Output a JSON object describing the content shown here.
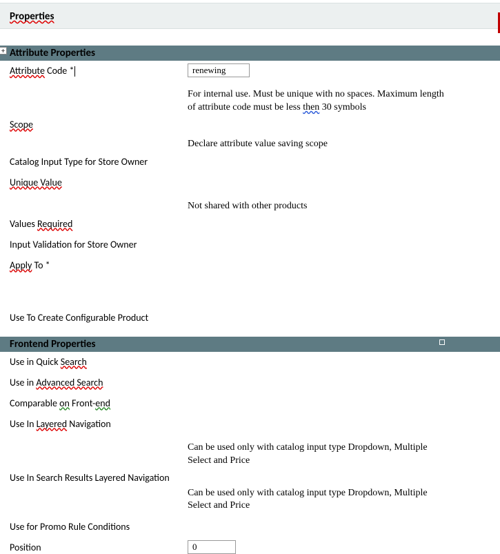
{
  "page": {
    "title": "Properties"
  },
  "sections": {
    "attr": {
      "title": "Attribute Properties"
    },
    "front": {
      "title": "Frontend Properties"
    }
  },
  "attr": {
    "code_label_1": "Attribute",
    "code_label_2": " Code ",
    "code_value": "renewing",
    "code_help_1": "For internal use. Must be unique with no spaces. Maximum length of attribute code must be less ",
    "code_help_then": "then",
    "code_help_2": " 30 symbols",
    "scope_label": "Scope",
    "scope_help": "Declare attribute value saving scope",
    "input_type_label": "Catalog Input Type for Store Owner",
    "unique_label": "Unique Value",
    "unique_help": "Not shared with other products",
    "required_label_1": "Values ",
    "required_label_2": "Required",
    "validation_label": "Input Validation for Store Owner",
    "apply_label_1": "Apply",
    "apply_label_2": " To *",
    "config_label": "Use To Create Configurable Product"
  },
  "front": {
    "quick_label_1": "Use in Quick ",
    "quick_label_2": "Search",
    "adv_label_1": "Use in ",
    "adv_label_2": "Advanced Search",
    "comp_label_1": "Comparable ",
    "comp_label_on": "on",
    "comp_label_2": " Front-",
    "comp_label_end": "end",
    "layered_label_1": "Use In ",
    "layered_label_2": "Layered",
    "layered_label_3": " Navigation",
    "layered_help": "Can be used only with catalog input type Dropdown, Multiple Select and Price",
    "results_label": "Use In Search Results Layered Navigation",
    "results_help": "Can be used only with catalog input type Dropdown, Multiple Select and Price",
    "promo_label": "Use for Promo Rule Conditions",
    "position_label": "Position",
    "position_value": "0"
  },
  "icons": {
    "expand": "+"
  }
}
